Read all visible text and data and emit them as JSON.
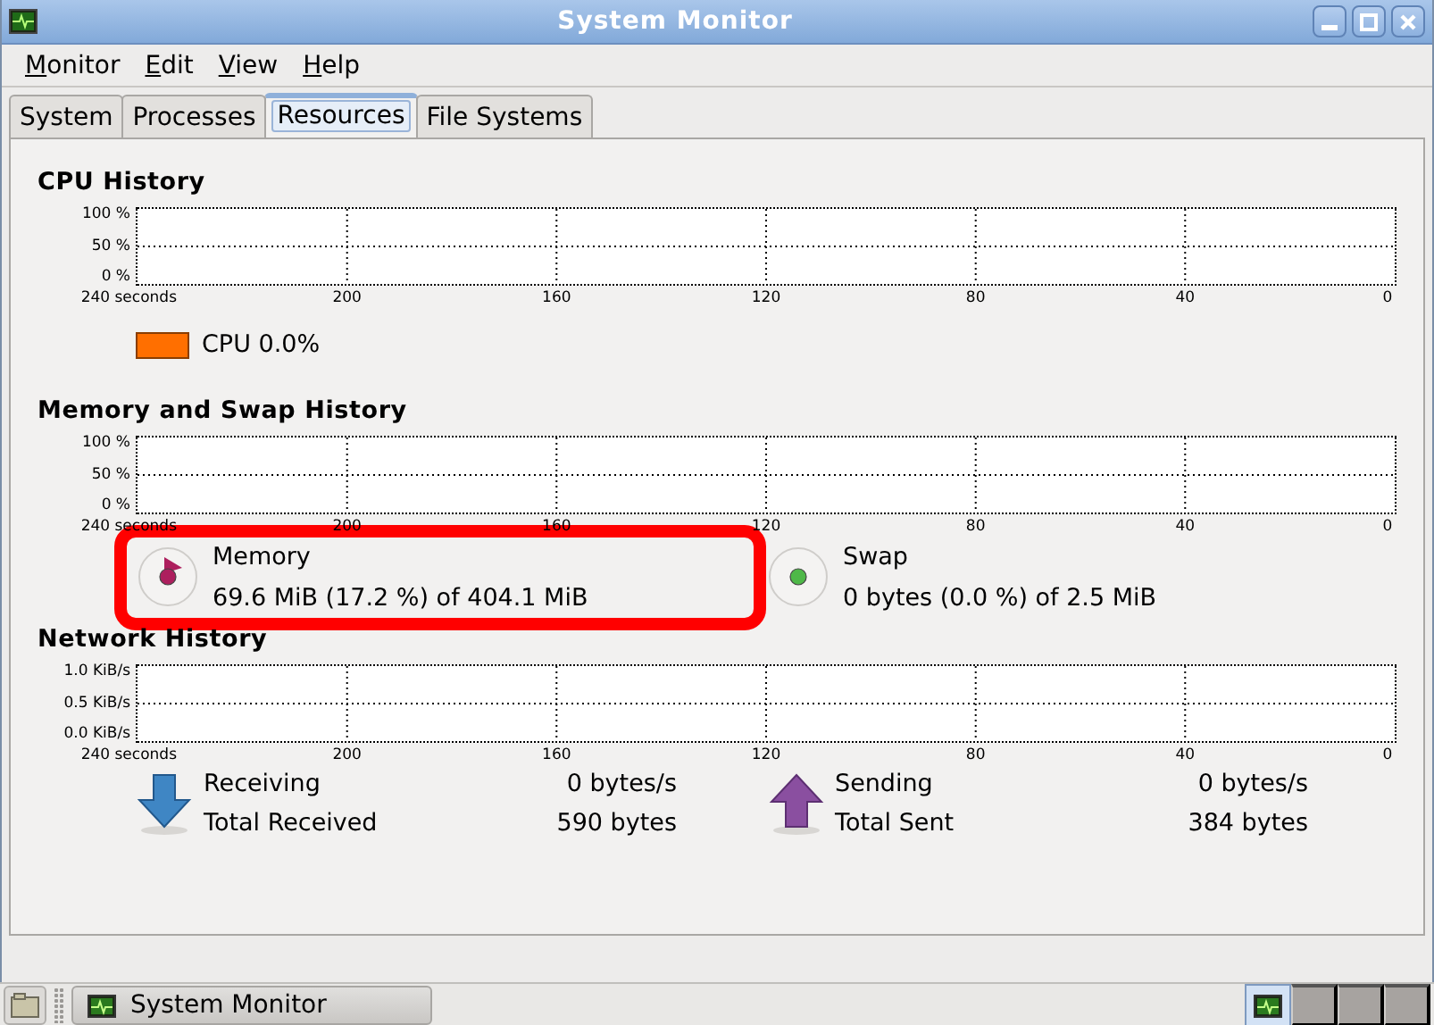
{
  "window": {
    "title": "System Monitor"
  },
  "menu": [
    "Monitor",
    "Edit",
    "View",
    "Help"
  ],
  "tabs": [
    {
      "label": "System",
      "selected": false
    },
    {
      "label": "Processes",
      "selected": false
    },
    {
      "label": "Resources",
      "selected": true
    },
    {
      "label": "File Systems",
      "selected": false
    }
  ],
  "sections": [
    {
      "title": "CPU History",
      "y_labels": [
        "100 %",
        "50 %",
        "0 %"
      ],
      "x_labels": [
        "240 seconds",
        "200",
        "160",
        "120",
        "80",
        "40",
        "0"
      ],
      "legend": [
        {
          "kind": "swatch",
          "label": "CPU",
          "value": "0.0%",
          "color": "#ff6f00"
        }
      ]
    },
    {
      "title": "Memory and Swap History",
      "y_labels": [
        "100 %",
        "50 %",
        "0 %"
      ],
      "x_labels": [
        "240 seconds",
        "200",
        "160",
        "120",
        "80",
        "40",
        "0"
      ],
      "legend": [
        {
          "kind": "pie",
          "label": "Memory",
          "value": "69.6 MiB (17.2 %) of 404.1 MiB",
          "color": "#ad1f5e",
          "highlighted": true
        },
        {
          "kind": "pie",
          "label": "Swap",
          "value": "0 bytes (0.0 %) of 2.5 MiB",
          "color": "#4eb848"
        }
      ]
    },
    {
      "title": "Network History",
      "y_labels": [
        "1.0 KiB/s",
        "0.5 KiB/s",
        "0.0 KiB/s"
      ],
      "x_labels": [
        "240 seconds",
        "200",
        "160",
        "120",
        "80",
        "40",
        "0"
      ],
      "legend": [
        {
          "kind": "download",
          "rows": [
            {
              "label": "Receiving",
              "value": "0 bytes/s"
            },
            {
              "label": "Total Received",
              "value": "590 bytes"
            }
          ]
        },
        {
          "kind": "upload",
          "rows": [
            {
              "label": "Sending",
              "value": "0 bytes/s"
            },
            {
              "label": "Total Sent",
              "value": "384 bytes"
            }
          ]
        }
      ]
    }
  ],
  "taskbar": {
    "tasks": [
      {
        "label": "System Monitor",
        "selected": false
      }
    ],
    "workspaces": [
      {
        "selected": true
      },
      {
        "selected": false
      },
      {
        "selected": false
      },
      {
        "selected": false
      }
    ]
  }
}
